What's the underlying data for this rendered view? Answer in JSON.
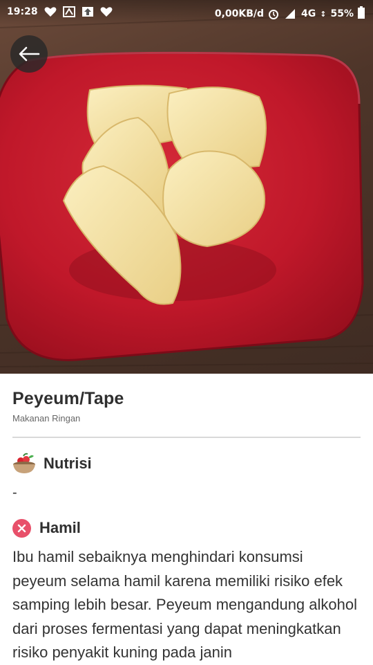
{
  "status_bar": {
    "time": "19:28",
    "left_icons": [
      "heart-icon",
      "box-icon",
      "upload-icon",
      "heart-icon"
    ],
    "network_speed": "0,00KB/d",
    "network_type": "4G",
    "battery": "55%"
  },
  "hero": {
    "image": "plate-of-peyeum-photo",
    "plate_color": "#c0182a"
  },
  "back_button": {
    "icon": "arrow-left-icon"
  },
  "food": {
    "title": "Peyeum/Tape",
    "category": "Makanan Ringan"
  },
  "nutrition": {
    "icon": "food-bowl-icon",
    "label": "Nutrisi",
    "value": "-"
  },
  "pregnancy": {
    "icon": "close-circle-icon",
    "status_color": "#e8506a",
    "label": "Hamil",
    "description": "Ibu hamil sebaiknya menghindari konsumsi peyeum selama hamil karena memiliki risiko efek samping lebih besar. Peyeum mengandung alkohol dari proses fermentasi yang dapat meningkatkan risiko penyakit kuning pada janin"
  }
}
